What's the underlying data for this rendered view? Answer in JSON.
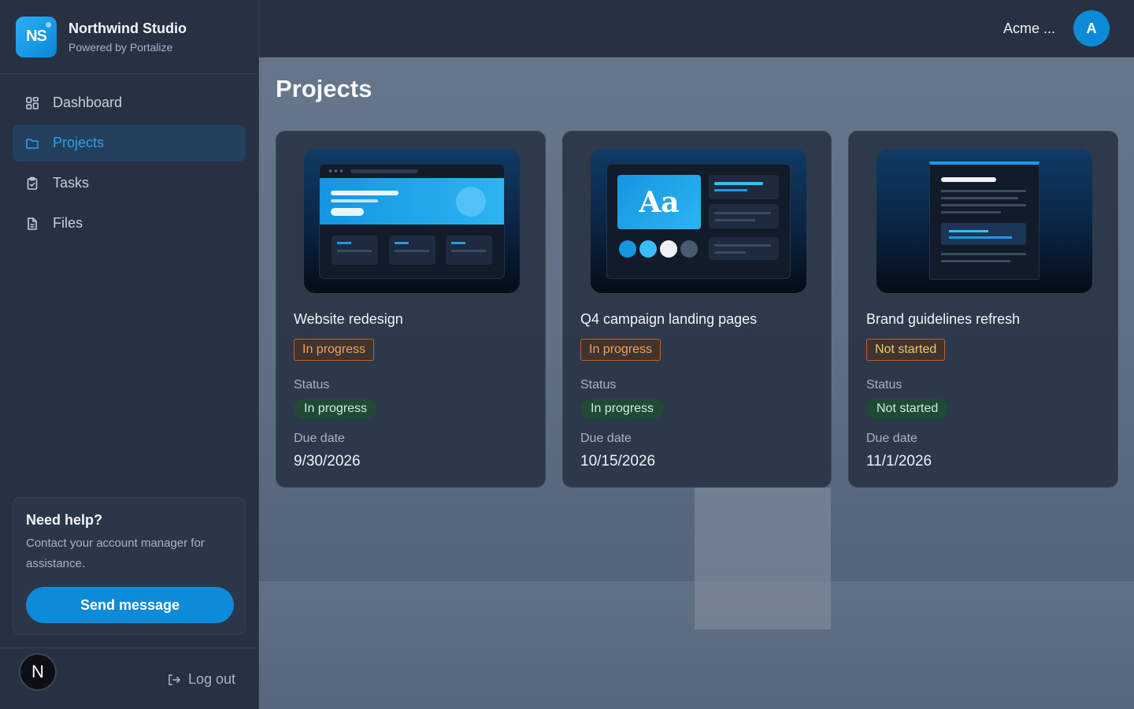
{
  "brand": {
    "initials": "NS",
    "name": "Northwind Studio",
    "subtitle": "Powered by Portalize"
  },
  "nav": {
    "items": [
      {
        "label": "Dashboard",
        "icon": "grid-icon",
        "active": false
      },
      {
        "label": "Projects",
        "icon": "folder-icon",
        "active": true
      },
      {
        "label": "Tasks",
        "icon": "clipboard-check-icon",
        "active": false
      },
      {
        "label": "Files",
        "icon": "file-icon",
        "active": false
      }
    ]
  },
  "help": {
    "title": "Need help?",
    "text": "Contact your account manager for assistance.",
    "button": "Send message"
  },
  "footer": {
    "avatar_letter": "N",
    "logout_label": "Log out"
  },
  "topbar": {
    "account_name": "Acme ...",
    "avatar_letter": "A"
  },
  "page": {
    "title": "Projects"
  },
  "projects": [
    {
      "title": "Website redesign",
      "tag": "In progress",
      "status_label": "Status",
      "status": "In progress",
      "due_label": "Due date",
      "due": "9/30/2026"
    },
    {
      "title": "Q4 campaign landing pages",
      "tag": "In progress",
      "status_label": "Status",
      "status": "In progress",
      "due_label": "Due date",
      "due": "10/15/2026"
    },
    {
      "title": "Brand guidelines refresh",
      "tag": "Not started",
      "status_label": "Status",
      "status": "Not started",
      "due_label": "Due date",
      "due": "11/1/2026"
    }
  ],
  "thumb2": {
    "type_sample": "Aa"
  },
  "colors": {
    "accent": "#0e8bd8",
    "active_nav_text": "#2c9ff0",
    "tag_orange": "#f3a15c",
    "tag_yellow": "#f0c86a",
    "pill_green_bg": "#1f4a35"
  }
}
